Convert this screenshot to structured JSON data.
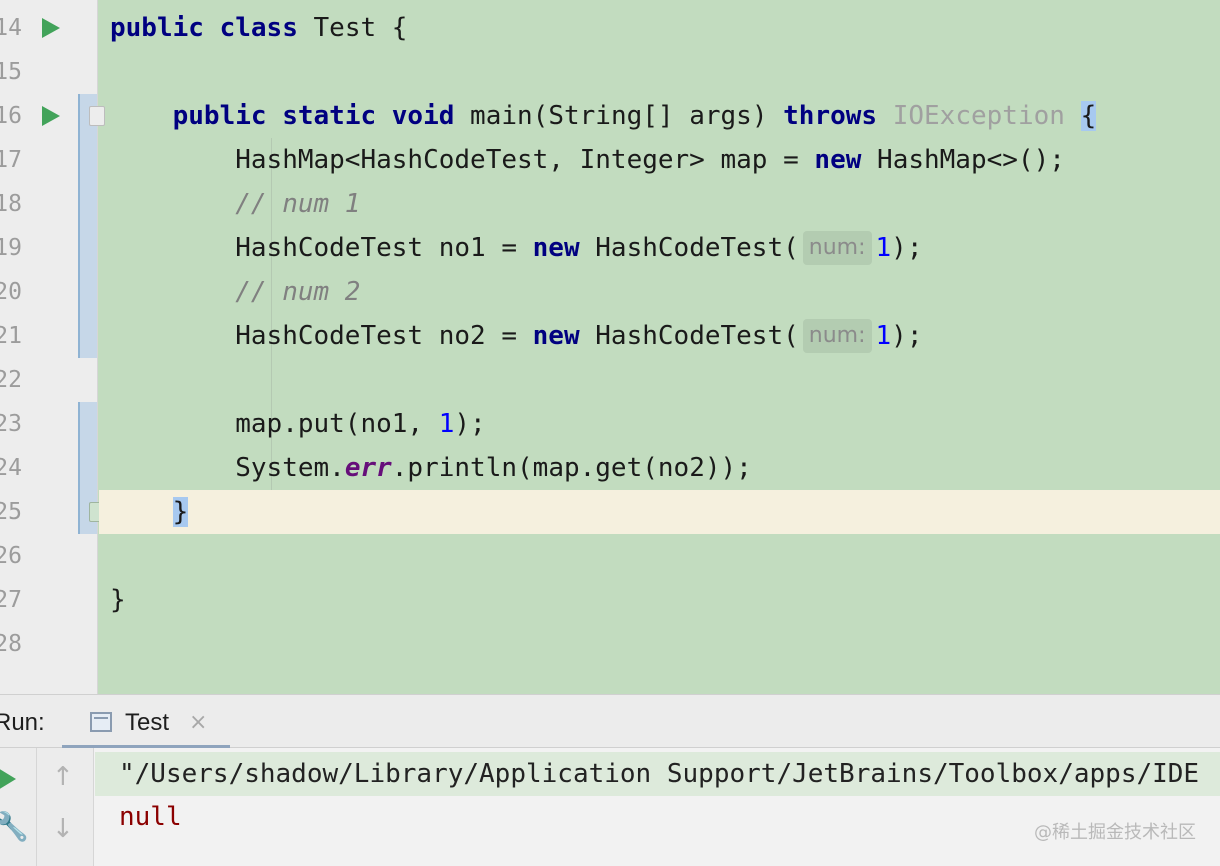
{
  "editor": {
    "line_numbers": [
      "14",
      "15",
      "16",
      "17",
      "18",
      "19",
      "20",
      "21",
      "22",
      "23",
      "24",
      "25",
      "26",
      "27",
      "28"
    ],
    "lines": {
      "l14": {
        "kw1": "public",
        "kw2": "class",
        "rest": " Test {"
      },
      "l16": {
        "kw1": "public",
        "kw2": "static",
        "kw3": "void",
        "mid": " main(String[] args) ",
        "kw4": "throws",
        "exc": "IOException",
        "brace": "{"
      },
      "l17": {
        "pre": "HashMap<HashCodeTest, Integer> map = ",
        "kw": "new",
        "post": " HashMap<>();"
      },
      "l18": {
        "comment": "// num 1"
      },
      "l19": {
        "pre": "HashCodeTest no1 = ",
        "kw": "new",
        "mid": " HashCodeTest(",
        "hint": "num:",
        "num": "1",
        "post": ");"
      },
      "l20": {
        "comment": "// num 2"
      },
      "l21": {
        "pre": "HashCodeTest no2 = ",
        "kw": "new",
        "mid": " HashCodeTest(",
        "hint": "num:",
        "num": "1",
        "post": ");"
      },
      "l23": {
        "pre": "map.put(no1, ",
        "num": "1",
        "post": ");"
      },
      "l24": {
        "pre": "System.",
        "field": "err",
        "post": ".println(map.get(no2));"
      },
      "l25": {
        "brace": "}"
      },
      "l27": {
        "brace": "}"
      }
    }
  },
  "run_panel": {
    "label": "Run:",
    "tab_label": "Test",
    "tab_close": "×",
    "icons": [
      "rerun-icon",
      "wrench-icon",
      "arrow-up-icon",
      "arrow-down-icon"
    ],
    "console": {
      "command": "\"/Users/shadow/Library/Application Support/JetBrains/Toolbox/apps/IDE",
      "output": "null"
    }
  },
  "watermark": "@稀土掘金技术社区",
  "colors": {
    "editor_background": "#c2dcbf",
    "keyword": "#000080",
    "number": "#0000ff",
    "comment": "#808080",
    "static_field": "#660e7a",
    "error_output": "#8b0000",
    "run_icon": "#42a35a"
  }
}
